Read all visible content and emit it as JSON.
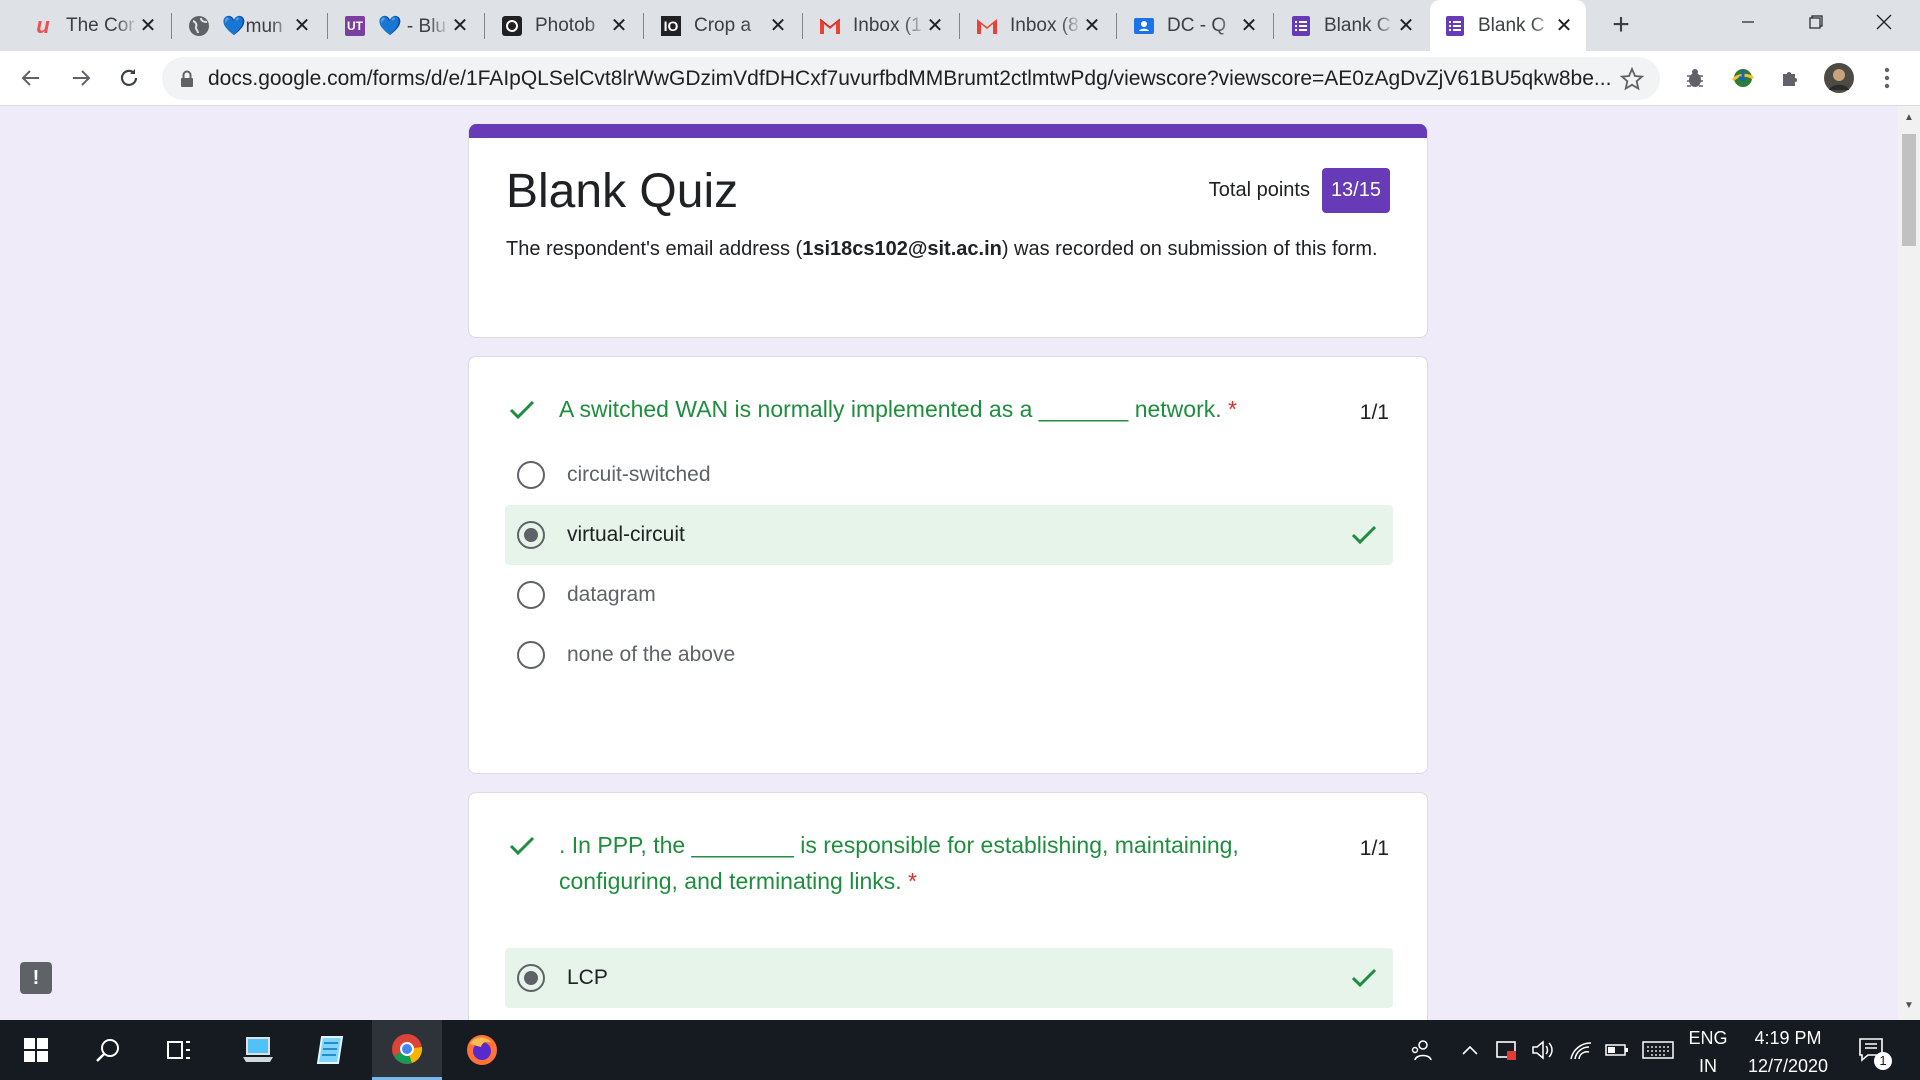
{
  "browser": {
    "tabs": [
      {
        "title": "The Cor",
        "icon": "udemy-icon"
      },
      {
        "title": "💙mun",
        "icon": "globe-icon"
      },
      {
        "title": "💙 - Blu",
        "icon": "ut-icon"
      },
      {
        "title": "Photob",
        "icon": "camera-icon"
      },
      {
        "title": "Crop a",
        "icon": "io-icon"
      },
      {
        "title": "Inbox (1",
        "icon": "gmail-icon"
      },
      {
        "title": "Inbox (8",
        "icon": "gmail-icon"
      },
      {
        "title": "DC - Q",
        "icon": "classroom-icon"
      },
      {
        "title": "Blank C",
        "icon": "forms-icon"
      },
      {
        "title": "Blank C",
        "icon": "forms-icon",
        "active": true
      }
    ],
    "url": "docs.google.com/forms/d/e/1FAIpQLSelCvt8lrWwGDzimVdfDHCxf7uvurfbdMMBrumt2ctlmtwPdg/viewscore?viewscore=AE0zAgDvZjV61BU5qkw8be..."
  },
  "quiz": {
    "title": "Blank Quiz",
    "points_label": "Total points",
    "points_value": "13/15",
    "email_prefix": "The respondent's email address (",
    "email": "1si18cs102@sit.ac.in",
    "email_suffix": ") was recorded on submission of this form.",
    "accent_color": "#673ab7",
    "correct_color": "#1e8e3e"
  },
  "questions": [
    {
      "text": "A switched WAN is normally implemented as a _______ network.",
      "required_mark": "*",
      "score": "1/1",
      "options": [
        "circuit-switched",
        "virtual-circuit",
        "datagram",
        "none of the above"
      ],
      "selected_index": 1
    },
    {
      "text": ". In PPP, the ________ is responsible for establishing, maintaining, configuring, and terminating links.",
      "required_mark": "*",
      "score": "1/1",
      "options": [
        "LCP"
      ],
      "selected_index": 0
    }
  ],
  "taskbar": {
    "language_top": "ENG",
    "language_bottom": "IN",
    "time": "4:19 PM",
    "date": "12/7/2020",
    "notification_count": "1"
  }
}
